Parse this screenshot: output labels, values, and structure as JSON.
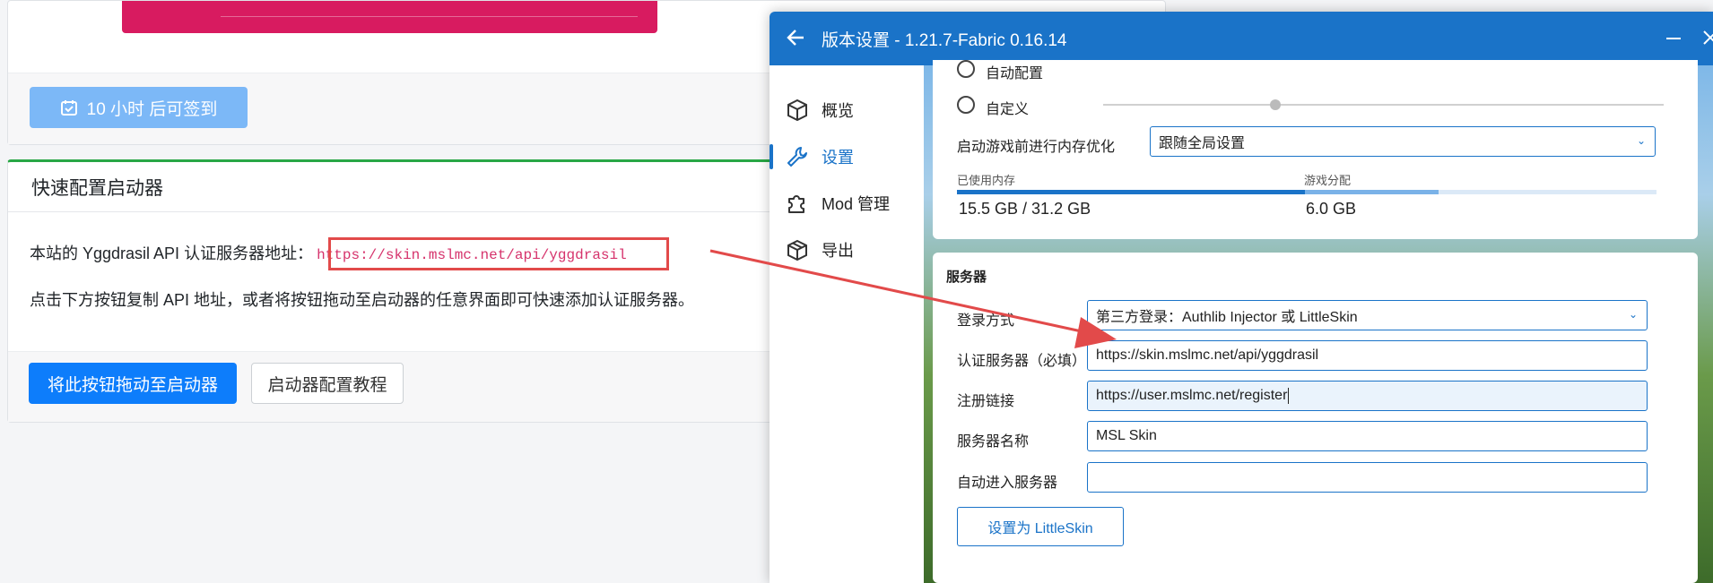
{
  "web": {
    "checkin_button": "10 小时 后可签到",
    "card_title": "快速配置启动器",
    "api_prefix": "本站的 Yggdrasil API 认证服务器地址：",
    "api_url": "https://skin.mslmc.net/api/yggdrasil",
    "instruction": "点击下方按钮复制 API 地址，或者将按钮拖动至启动器的任意界面即可快速添加认证服务器。",
    "drag_button": "将此按钮拖动至启动器",
    "tutorial_button": "启动器配置教程",
    "top_right_link": "https://user.mslmc.net"
  },
  "launcher": {
    "title": "版本设置 - 1.21.7-Fabric 0.16.14",
    "nav": [
      {
        "label": "概览",
        "icon": "cube-icon"
      },
      {
        "label": "设置",
        "icon": "wrench-icon",
        "active": true
      },
      {
        "label": "Mod 管理",
        "icon": "puzzle-icon"
      },
      {
        "label": "导出",
        "icon": "box-icon"
      }
    ],
    "memory": {
      "radio_auto": "自动配置",
      "radio_custom": "自定义",
      "optimize_label": "启动游戏前进行内存优化",
      "optimize_value": "跟随全局设置",
      "used_label": "已使用内存",
      "used_value": "15.5 GB / 31.2 GB",
      "alloc_label": "游戏分配",
      "alloc_value": "6.0 GB",
      "used_fraction": 0.497,
      "alloc_fraction": 0.192
    },
    "server": {
      "section_title": "服务器",
      "login_label": "登录方式",
      "login_value": "第三方登录：Authlib Injector 或 LittleSkin",
      "auth_label": "认证服务器（必填）",
      "auth_value": "https://skin.mslmc.net/api/yggdrasil",
      "register_label": "注册链接",
      "register_value": "https://user.mslmc.net/register",
      "name_label": "服务器名称",
      "name_value": "MSL Skin",
      "autojoin_label": "自动进入服务器",
      "autojoin_value": "",
      "set_button": "设置为 LittleSkin"
    }
  },
  "colors": {
    "accent": "#1a73c8",
    "annotation": "#e24a4a",
    "pink": "#d81b60",
    "primary": "#0d7dfb"
  }
}
